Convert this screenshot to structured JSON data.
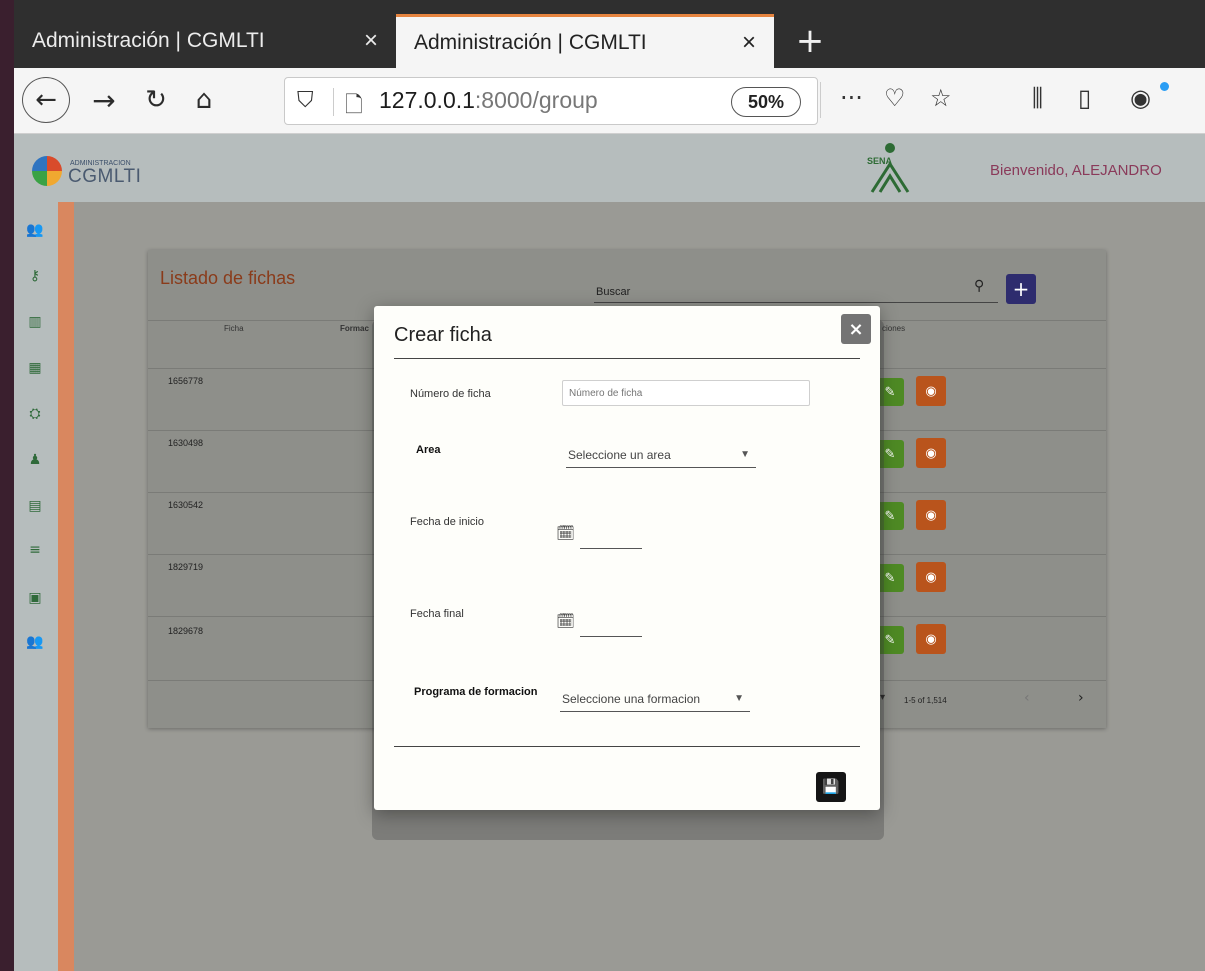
{
  "browser": {
    "tabs": [
      {
        "title": "Administración | CGMLTI",
        "close": "×"
      },
      {
        "title": "Administración | CGMLTI",
        "close": "×"
      }
    ],
    "new_tab": "+",
    "url_host": "127.0.0.1",
    "url_path": ":8000/group",
    "zoom": "50%"
  },
  "header": {
    "logo_small": "ADMINISTRACION",
    "logo_big": "CGMLTI",
    "sena": "SENA",
    "welcome": "Bienvenido, ALEJANDRO"
  },
  "card": {
    "title": "Listado de fichas",
    "search_label": "Buscar",
    "add_label": "+",
    "columns": [
      "Ficha",
      "Formac",
      "ciones"
    ],
    "rows": [
      "1656778",
      "1630498",
      "1630542",
      "1829719",
      "1829678"
    ],
    "pagination": {
      "range": "1-5 of 1,514",
      "prev": "‹",
      "next": "›"
    }
  },
  "modal": {
    "title": "Crear ficha",
    "close": "×",
    "numero_label": "Número de ficha",
    "numero_placeholder": "Número de ficha",
    "area_label": "Area",
    "area_select": "Seleccione un area",
    "inicio_label": "Fecha de inicio",
    "final_label": "Fecha final",
    "programa_label": "Programa de formacion",
    "programa_select": "Seleccione una formacion"
  },
  "colors": {
    "accent": "#d9875f",
    "title": "#8a3b1a",
    "edit": "#4e8a24",
    "view": "#b9541c",
    "add": "#2e2c6e"
  }
}
